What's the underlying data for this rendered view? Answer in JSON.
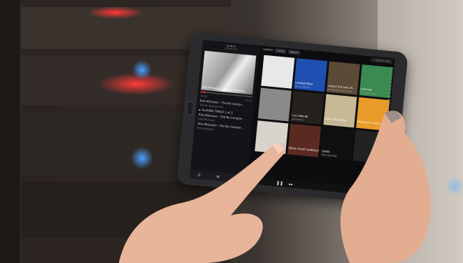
{
  "app": {
    "header_logo": "Qobuz",
    "header_sub": "CONNECTED"
  },
  "now_playing": {
    "artist_caption": "Rita Mitsouko - The No Comprendo",
    "track_title": "Rita Mitsouko - The No Compr...",
    "track_album": "The No Comprendo",
    "time_elapsed": "00:01",
    "time_total": "11:27",
    "progress": 0.1,
    "playing_label": "PLAYING TRACK 1 of 2",
    "queue": [
      {
        "title": "Rita Mitsouko - The No Compre...",
        "sub": "Rita Mitsouko"
      },
      {
        "title": "Rita Mitsouko - The No Compre...",
        "sub": "Rita Mitsouko"
      }
    ]
  },
  "library": {
    "label": "LIBRARY",
    "tabs": [
      "Artist",
      "Album"
    ],
    "search_placeholder": "Search Text",
    "albums": [
      {
        "title": "",
        "sub": "",
        "color": "#e8e8e8"
      },
      {
        "title": "LateNightTales",
        "sub": "Various Artists",
        "color": "#1f4fb0"
      },
      {
        "title": "Legend (the best of)...",
        "sub": "Bob Marley and the Wa...",
        "color": "#5a4a36"
      },
      {
        "title": "Little Hell",
        "sub": "City and Colour",
        "color": "#3a8a52"
      },
      {
        "title": "",
        "sub": "",
        "color": "#8a8a8a"
      },
      {
        "title": "Live 1980-86",
        "sub": "Joe Jackson",
        "color": "#24201c"
      },
      {
        "title": "Lost in the Dream",
        "sub": "The War On Drugs",
        "color": "#c8b896"
      },
      {
        "title": "Movement In Still Life",
        "sub": "BT",
        "color": "#e89c2a"
      },
      {
        "title": "",
        "sub": "",
        "color": "#d8d4cc"
      },
      {
        "title": "JESUS CHRIST SUPERSTAR",
        "sub": "",
        "color": "#5a2a20"
      },
      {
        "title": "LORDE",
        "sub": "PURE HEROINE",
        "color": "#101010"
      },
      {
        "title": "",
        "sub": "",
        "color": "#222"
      }
    ]
  }
}
